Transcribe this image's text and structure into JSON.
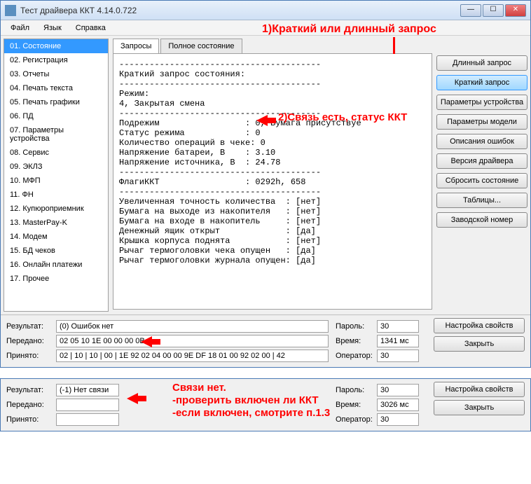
{
  "window": {
    "title": "Тест драйвера ККТ 4.14.0.722",
    "min": "—",
    "max": "☐",
    "close": "✕"
  },
  "menu": {
    "file": "Файл",
    "lang": "Язык",
    "help": "Справка"
  },
  "annotations": {
    "a1": "1)Краткий или длинный запрос",
    "a2": "2)Связь есть, статус ККТ",
    "a3_l1": "Связи нет.",
    "a3_l2": "-проверить включен ли ККТ",
    "a3_l3": "-если включен, смотрите п.1.3"
  },
  "sidebar": {
    "items": [
      "01. Состояние",
      "02. Регистрация",
      "03. Отчеты",
      "04. Печать текста",
      "05. Печать графики",
      "06. ПД",
      "07. Параметры устройства",
      "08. Сервис",
      "09. ЭКЛЗ",
      "10. МФП",
      "11. ФН",
      "12. Купюроприемник",
      "13. MasterPay-K",
      "14. Модем",
      "15. БД чеков",
      "16. Онлайн платежи",
      "17. Прочее"
    ]
  },
  "tabs": {
    "t1": "Запросы",
    "t2": "Полное состояние"
  },
  "report": "----------------------------------------\nКраткий запрос состояния:\n----------------------------------------\nРежим:\n4, Закрытая смена\n----------------------------------------\nПодрежим                 : 0, Бумага присутствуе\nСтатус режима            : 0\nКоличество операций в чеке: 0\nНапряжение батареи, В    : 3.10\nНапряжение источника, В  : 24.78\n----------------------------------------\nФлагиККТ                 : 0292h, 658\n----------------------------------------\nУвеличенная точность количества  : [нет]\nБумага на выходе из накопителя   : [нет]\nБумага на входе в накопитель     : [нет]\nДенежный ящик открыт             : [да]\nКрышка корпуса поднята           : [нет]\nРычаг термоголовки чека опущен   : [да]\nРычаг термоголовки журнала опущен: [да]",
  "buttons": {
    "long_req": "Длинный запрос",
    "short_req": "Краткий запрос",
    "dev_params": "Параметры устройства",
    "model_params": "Параметры модели",
    "err_desc": "Описания ошибок",
    "drv_ver": "Версия драйвера",
    "reset_state": "Сбросить состояние",
    "tables": "Таблицы...",
    "serial": "Заводской номер"
  },
  "footer": {
    "result_label": "Результат:",
    "result": "(0) Ошибок нет",
    "sent_label": "Передано:",
    "sent": "02 05 10 1E 00 00 00 0B",
    "recv_label": "Принято:",
    "recv": "02 | 10 | 10 | 00 | 1E 92 02 04 00 00 9E DF 18 01 00 92 02 00 | 42",
    "pass_label": "Пароль:",
    "pass": "30",
    "time_label": "Время:",
    "time": "1341 мс",
    "oper_label": "Оператор:",
    "oper": "30",
    "props_btn": "Настройка свойств",
    "close_btn": "Закрыть"
  },
  "footer2": {
    "result": "(-1) Нет связи",
    "sent": "",
    "recv": "",
    "time": "3026 мс",
    "pass": "30",
    "oper": "30"
  }
}
